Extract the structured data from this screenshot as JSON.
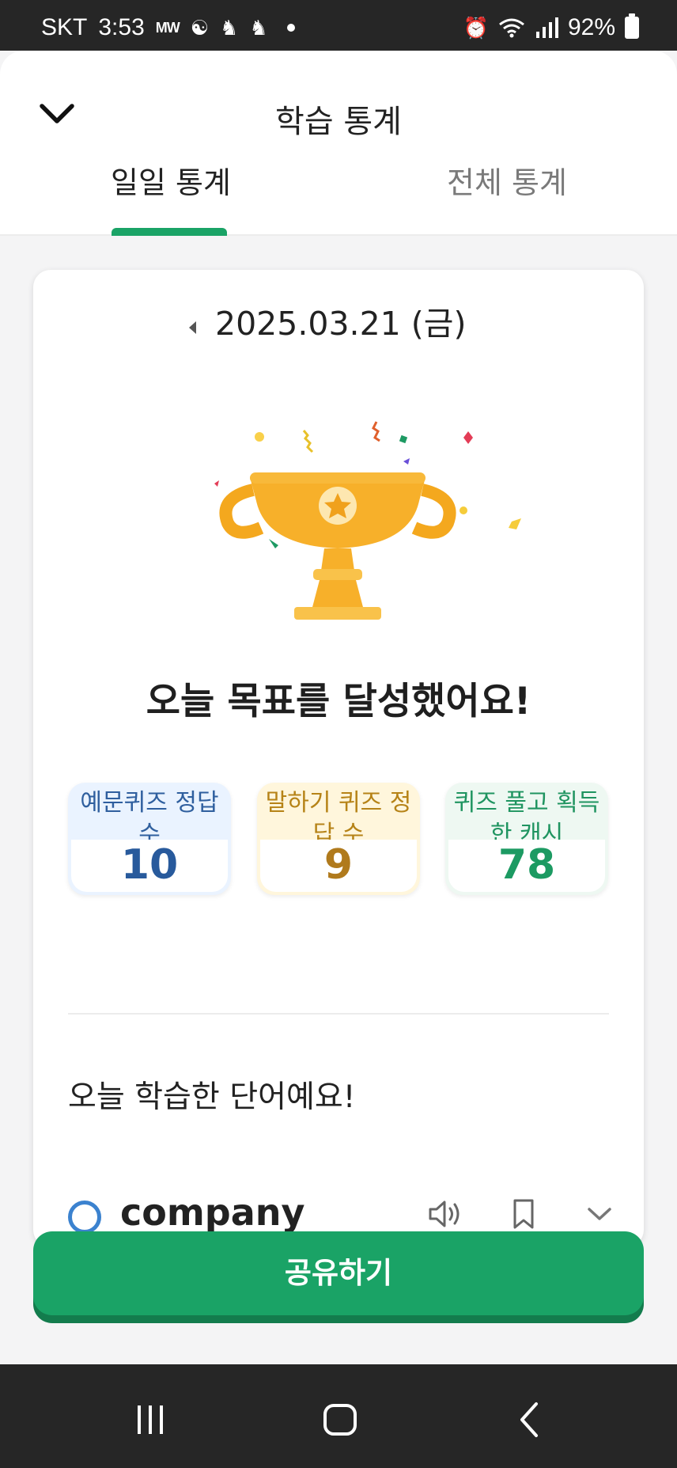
{
  "status_bar": {
    "carrier": "SKT",
    "time": "3:53",
    "mini_text": "MW",
    "battery_percent": "92%"
  },
  "header": {
    "title": "학습 통계",
    "back_icon": "chevron-down-icon",
    "tabs": [
      {
        "label": "일일 통계",
        "active": true
      },
      {
        "label": "전체 통계",
        "active": false
      }
    ]
  },
  "card": {
    "date": "2025.03.21 (금)",
    "goal_message": "오늘 목표를 달성했어요!",
    "stats": [
      {
        "label": "예문퀴즈 정답 수",
        "value": "10",
        "color": "#285a9c"
      },
      {
        "label": "말하기 퀴즈 정답 수",
        "value": "9",
        "color": "#b07a1c"
      },
      {
        "label": "퀴즈 풀고 획득한 캐시",
        "value": "78",
        "color": "#1c9a62"
      }
    ],
    "words_title": "오늘 학습한 단어예요!",
    "words": [
      {
        "word": "company",
        "icons": [
          "speaker-icon",
          "bookmark-icon",
          "chevron-down-icon"
        ]
      }
    ]
  },
  "share_button": {
    "label": "공유하기",
    "color": "#1aa366"
  },
  "nav_bar": {
    "icons": [
      "recents-icon",
      "home-icon",
      "back-icon"
    ]
  }
}
